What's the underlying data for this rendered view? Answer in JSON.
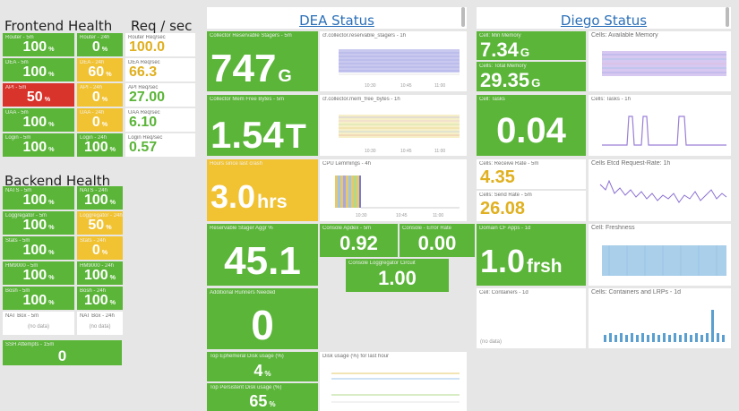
{
  "frontend": {
    "title": "Frontend Health",
    "tiles": [
      {
        "label": "Router - 5m",
        "value": "100",
        "unit": "%"
      },
      {
        "label": "Router - 24h",
        "value": "0",
        "unit": "%"
      },
      {
        "label": "DEA - 5m",
        "value": "100",
        "unit": "%"
      },
      {
        "label": "DEA - 24h",
        "value": "60",
        "unit": "%"
      },
      {
        "label": "API - 5m",
        "value": "50",
        "unit": "%"
      },
      {
        "label": "API - 24h",
        "value": "0",
        "unit": "%"
      },
      {
        "label": "UAA - 5m",
        "value": "100",
        "unit": "%"
      },
      {
        "label": "UAA - 24h",
        "value": "0",
        "unit": "%"
      },
      {
        "label": "Login - 5m",
        "value": "100",
        "unit": "%"
      },
      {
        "label": "Login - 24h",
        "value": "100",
        "unit": "%"
      }
    ]
  },
  "req": {
    "title": "Req / sec",
    "tiles": [
      {
        "label": "Router Req/sec",
        "value": "100.0"
      },
      {
        "label": "DEA Req/sec",
        "value": "66.3"
      },
      {
        "label": "API Req/sec",
        "value": "27.00"
      },
      {
        "label": "UAA Req/sec",
        "value": "6.10"
      },
      {
        "label": "Login Req/sec",
        "value": "0.57"
      }
    ]
  },
  "backend": {
    "title": "Backend Health",
    "tiles": [
      {
        "label": "NATS - 5m",
        "value": "100",
        "unit": "%"
      },
      {
        "label": "NATS - 24h",
        "value": "100",
        "unit": "%"
      },
      {
        "label": "Loggregator - 5m",
        "value": "100",
        "unit": "%"
      },
      {
        "label": "Loggregator - 24h",
        "value": "50",
        "unit": "%"
      },
      {
        "label": "Stats - 5m",
        "value": "100",
        "unit": "%"
      },
      {
        "label": "Stats - 24h",
        "value": "0",
        "unit": "%"
      },
      {
        "label": "HM9000 - 5m",
        "value": "100",
        "unit": "%"
      },
      {
        "label": "HM9000 - 24h",
        "value": "100",
        "unit": "%"
      },
      {
        "label": "Bosh - 5m",
        "value": "100",
        "unit": "%"
      },
      {
        "label": "Bosh - 24h",
        "value": "100",
        "unit": "%"
      },
      {
        "label": "NAT Box - 5m",
        "value": "(no data)",
        "unit": ""
      },
      {
        "label": "NAT Box - 24h",
        "value": "(no data)",
        "unit": ""
      }
    ],
    "ssh": {
      "label": "SSH Attempts - 15m",
      "value": "0"
    }
  },
  "dea": {
    "title": "DEA Status",
    "stagers": {
      "label": "Collector Reservable Stagers - 5m",
      "value": "747",
      "unit": "G"
    },
    "stagers_chart": {
      "label": "cf.collector.reservable_stagers - 1h"
    },
    "mem": {
      "label": "Collector Mem Free Bytes - 5m",
      "value": "1.54",
      "unit": "T"
    },
    "mem_chart": {
      "label": "cf.collector.mem_free_bytes - 1h"
    },
    "crash": {
      "label": "Hours since last crash",
      "value": "3.0",
      "unit": "hrs"
    },
    "lemmings": {
      "label": "CPU Lemmings - 4h"
    },
    "aggr": {
      "label": "Reservable Stager Aggr %",
      "value": "45.1"
    },
    "apdex": {
      "label": "Console Apdex - 5m",
      "value": "0.92"
    },
    "error_rate": {
      "label": "Console - Error Rate",
      "value": "0.00"
    },
    "loggregator_circuit": {
      "label": "Console Loggregator Circuit",
      "value": "1.00"
    },
    "runners": {
      "label": "Additional Runners Needed",
      "value": "0"
    },
    "eph_disk": {
      "label": "Top Ephemeral Disk usage (%)",
      "value": "4",
      "unit": "%"
    },
    "pers_disk": {
      "label": "Top Persistent Disk usage (%)",
      "value": "65",
      "unit": "%"
    },
    "disk_chart": {
      "label": "Disk usage (%) for last hour"
    },
    "x_ticks": [
      "10:30",
      "10:45",
      "11:00"
    ]
  },
  "diego": {
    "title": "Diego Status",
    "min_mem": {
      "label": "Cell: Min Memory",
      "value": "7.34",
      "unit": "G"
    },
    "total_mem": {
      "label": "Cells: Total Memory",
      "value": "29.35",
      "unit": "G"
    },
    "avail_mem": {
      "label": "Cells: Available Memory"
    },
    "tasks": {
      "label": "Cell: Tasks",
      "value": "0.04"
    },
    "tasks_chart": {
      "label": "Cells: Tasks - 1h"
    },
    "receive": {
      "label": "Cells: Receive Rate - 5m",
      "value": "4.35"
    },
    "send": {
      "label": "Cells: Send Rate - 5m",
      "value": "26.08"
    },
    "etcd": {
      "label": "Cells Etcd Request-Rate: 1h"
    },
    "apps": {
      "label": "Domain CF Apps - 1d",
      "value": "1.0",
      "unit": "frsh"
    },
    "freshness": {
      "label": "Cell: Freshness"
    },
    "containers": {
      "label": "Cell: Containers - 1d",
      "value": "(no data)"
    },
    "containers_lrps": {
      "label": "Cells: Containers and LRPs - 1d"
    }
  },
  "colors": {
    "green": "#5ab538",
    "yellow": "#f1c232",
    "red": "#d9342b",
    "chart_blue": "#6aaed6"
  }
}
